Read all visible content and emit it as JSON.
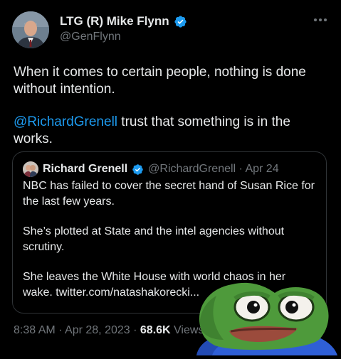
{
  "author": {
    "display_name": "LTG (R) Mike Flynn",
    "handle": "@GenFlynn"
  },
  "tweet": {
    "text_line1": "When it comes to certain people, nothing is done without intention.",
    "mention": "@RichardGrenell",
    "text_after_mention": " trust that something is in the works."
  },
  "quote": {
    "display_name": "Richard Grenell",
    "handle_and_date": "@RichardGrenell · Apr 24",
    "paragraphs": [
      "NBC has failed to cover the secret hand of Susan Rice for the last few years.",
      "She’s plotted at State and the intel agencies without scrutiny.",
      "She leaves the White House with world chaos in her wake. twitter.com/natashakorecki..."
    ]
  },
  "meta": {
    "timestamp": "8:38 AM · Apr 28, 2023 · ",
    "views_count": "68.6K",
    "views_label": " Views"
  },
  "colors": {
    "background": "#000000",
    "text": "#e7e9ea",
    "muted": "#71767b",
    "link": "#1d9bf0",
    "border": "#2f3336"
  },
  "icons": [
    "verified-badge-icon",
    "more-options-icon"
  ]
}
